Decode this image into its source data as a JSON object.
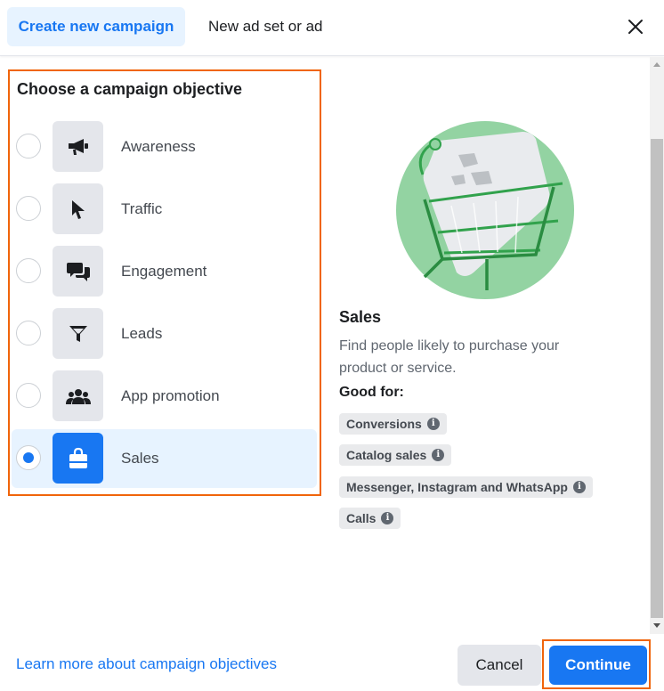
{
  "header": {
    "tabs": [
      {
        "label": "Create new campaign",
        "active": true
      },
      {
        "label": "New ad set or ad",
        "active": false
      }
    ],
    "close_icon": "close-icon"
  },
  "objectives": {
    "heading": "Choose a campaign objective",
    "selected": "Sales",
    "items": [
      {
        "label": "Awareness",
        "icon": "megaphone-icon"
      },
      {
        "label": "Traffic",
        "icon": "cursor-icon"
      },
      {
        "label": "Engagement",
        "icon": "chat-bubbles-icon"
      },
      {
        "label": "Leads",
        "icon": "funnel-icon"
      },
      {
        "label": "App promotion",
        "icon": "people-icon"
      },
      {
        "label": "Sales",
        "icon": "shopping-bag-icon"
      }
    ]
  },
  "detail": {
    "title": "Sales",
    "description": "Find people likely to purchase your product or service.",
    "good_for_label": "Good for:",
    "good_for": [
      "Conversions",
      "Catalog sales",
      "Messenger, Instagram and WhatsApp",
      "Calls"
    ]
  },
  "footer": {
    "learn_more": "Learn more about campaign objectives",
    "cancel": "Cancel",
    "continue": "Continue"
  },
  "colors": {
    "accent": "#1877f2",
    "highlight_outline": "#f0650b",
    "illustration_green": "#31a24c"
  }
}
